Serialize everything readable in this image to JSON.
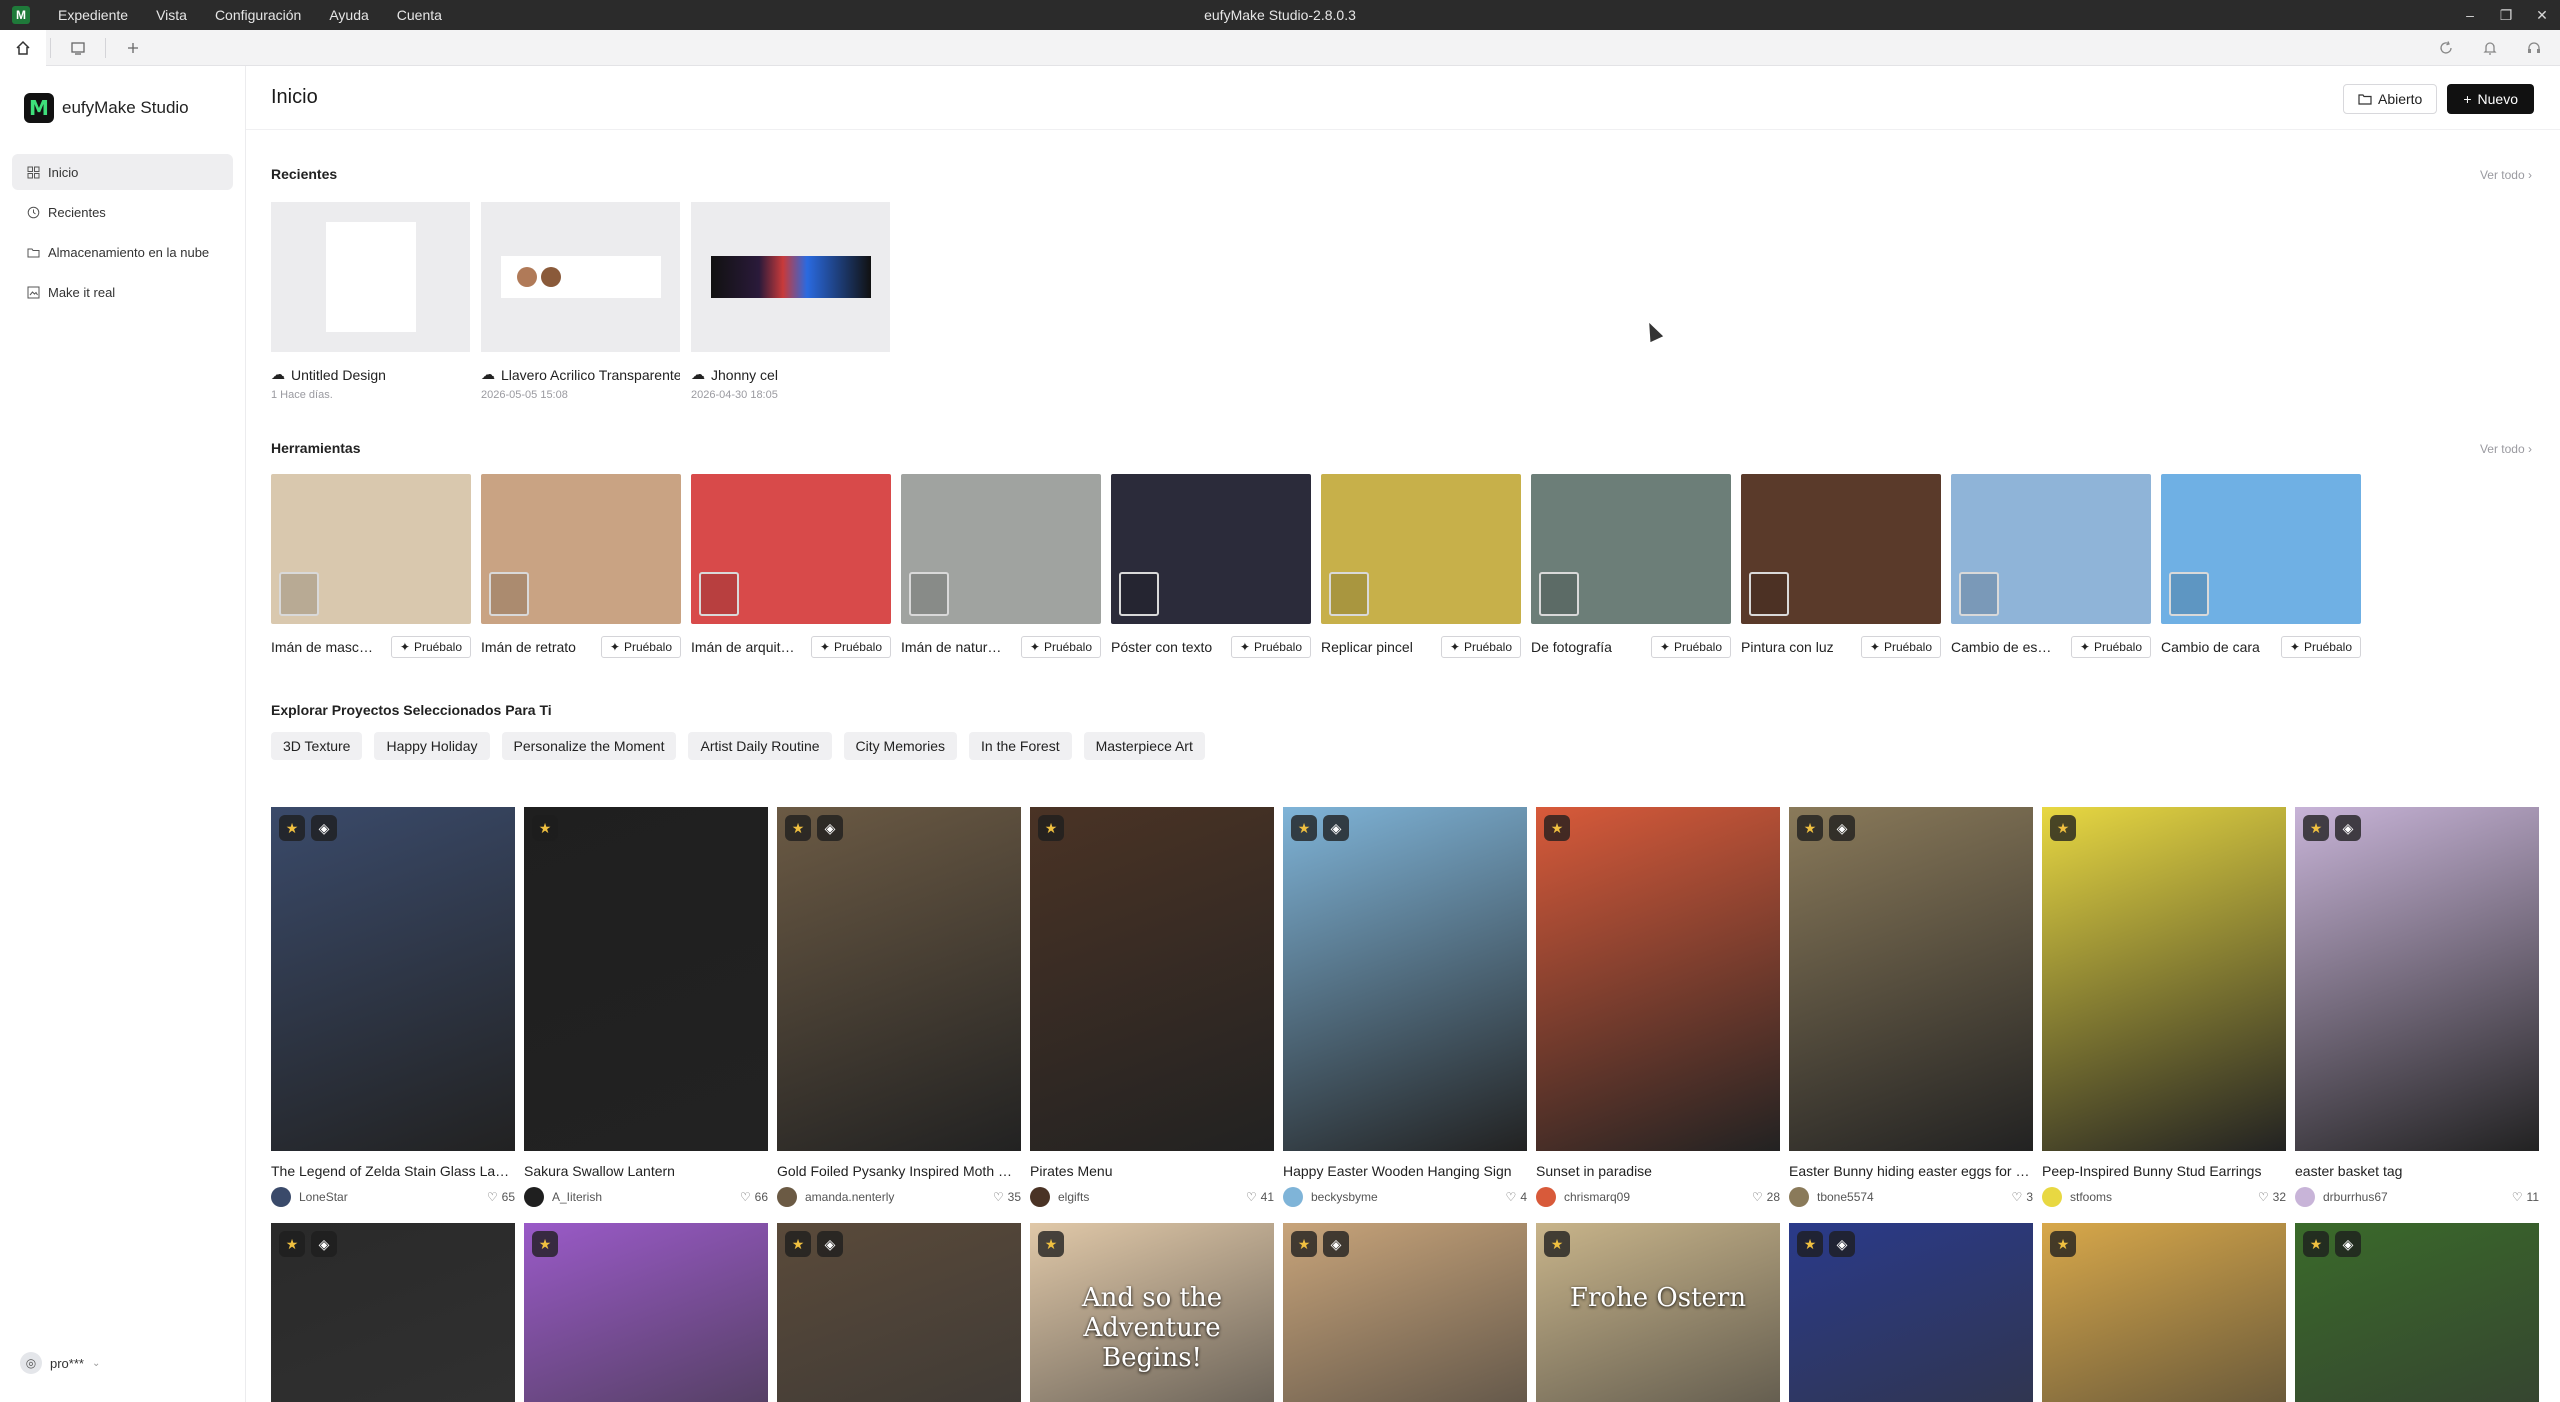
{
  "window": {
    "title": "eufyMake Studio-2.8.0.3",
    "menu": [
      "Expediente",
      "Vista",
      "Configuración",
      "Ayuda",
      "Cuenta"
    ],
    "app_logo_letter": "M"
  },
  "sidebar": {
    "brand": "eufyMake Studio",
    "items": [
      {
        "label": "Inicio",
        "icon": "grid-icon",
        "active": true
      },
      {
        "label": "Recientes",
        "icon": "clock-icon",
        "active": false
      },
      {
        "label": "Almacenamiento en la nube",
        "icon": "cloud-folder-icon",
        "active": false
      },
      {
        "label": "Make it real",
        "icon": "image-icon",
        "active": false
      }
    ],
    "user": "pro***"
  },
  "header": {
    "title": "Inicio",
    "open_label": "Abierto",
    "new_label": "Nuevo"
  },
  "recents": {
    "title": "Recientes",
    "see_all": "Ver todo",
    "items": [
      {
        "name": "Untitled Design",
        "date": "1 Hace días."
      },
      {
        "name": "Llavero Acrilico Transparente",
        "date": "2026-05-05 15:08"
      },
      {
        "name": "Jhonny cel",
        "date": "2026-04-30 18:05"
      }
    ]
  },
  "tools": {
    "title": "Herramientas",
    "see_all": "Ver todo",
    "try_label": "Pruébalo",
    "items": [
      {
        "name": "Imán de mascota",
        "color": "#d9c8ae"
      },
      {
        "name": "Imán de retrato",
        "color": "#c9a383"
      },
      {
        "name": "Imán de arquitectura",
        "color": "#d84a4a"
      },
      {
        "name": "Imán de naturaleza",
        "color": "#a0a3a0"
      },
      {
        "name": "Póster con texto",
        "color": "#2b2b3a"
      },
      {
        "name": "Replicar pincel",
        "color": "#c7b04a"
      },
      {
        "name": "De fotografía",
        "color": "#6c7e78"
      },
      {
        "name": "Pintura con luz",
        "color": "#5a3a2a"
      },
      {
        "name": "Cambio de estilo",
        "color": "#8fb4d8"
      },
      {
        "name": "Cambio de cara",
        "color": "#6fb0e4"
      }
    ]
  },
  "explore": {
    "title": "Explorar Proyectos Seleccionados Para Ti",
    "chips": [
      "3D Texture",
      "Happy Holiday",
      "Personalize the Moment",
      "Artist Daily Routine",
      "City Memories",
      "In the Forest",
      "Masterpiece Art"
    ]
  },
  "projects": [
    {
      "title": "The Legend of Zelda Stain Glass Lantern",
      "author": "LoneStar",
      "likes": "65",
      "color": "#3a4a6a"
    },
    {
      "title": "Sakura Swallow Lantern",
      "author": "A_Iiterish",
      "likes": "66",
      "color": "#1f1f1f"
    },
    {
      "title": "Gold Foiled Pysanky Inspired Moth Earrings",
      "author": "amanda.nenterly",
      "likes": "35",
      "color": "#6b5a44"
    },
    {
      "title": "Pirates Menu",
      "author": "elgifts",
      "likes": "41",
      "color": "#4a3325"
    },
    {
      "title": "Happy Easter Wooden Hanging Sign",
      "author": "beckysbyme",
      "likes": "4",
      "color": "#7fb4d8"
    },
    {
      "title": "Sunset in paradise",
      "author": "chrismarq09",
      "likes": "28",
      "color": "#d85a3a"
    },
    {
      "title": "Easter Bunny hiding easter eggs for kids",
      "author": "tbone5574",
      "likes": "3",
      "color": "#8a7a5a"
    },
    {
      "title": "Peep-Inspired Bunny Stud Earrings",
      "author": "stfooms",
      "likes": "32",
      "color": "#e8d842"
    },
    {
      "title": "easter basket tag",
      "author": "drburrhus67",
      "likes": "11",
      "color": "#c8b4d8"
    }
  ],
  "projects_row2": [
    {
      "color": "#2a2a2a"
    },
    {
      "color": "#9a5ac8"
    },
    {
      "color": "#5a4a3a"
    },
    {
      "color": "#e0c8a8",
      "text": "And so the Adventure Begins!"
    },
    {
      "color": "#c8a47a"
    },
    {
      "color": "#c8b48a",
      "text": "Frohe Ostern"
    },
    {
      "color": "#2a3a8a"
    },
    {
      "color": "#d8a84a"
    },
    {
      "color": "#3a6a2a"
    }
  ],
  "colors": {
    "accent": "#111111",
    "titlebar": "#2b2b2b",
    "chip_bg": "#f0f0f2"
  }
}
